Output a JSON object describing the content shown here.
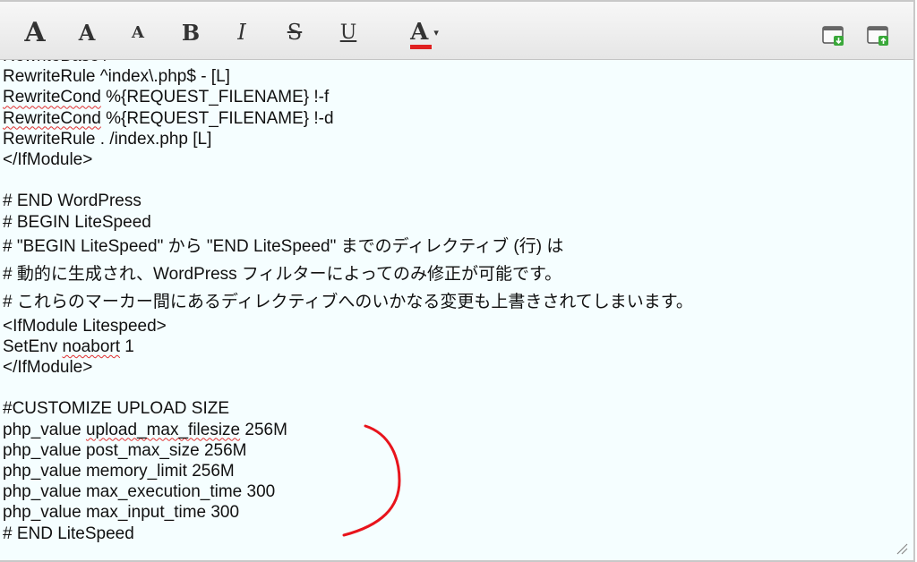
{
  "toolbar": {
    "font_large": "A",
    "font_medium": "A",
    "font_small": "A",
    "bold": "B",
    "italic": "I",
    "strike": "S",
    "underline": "U",
    "text_color": "A",
    "text_color_caret": "▾",
    "text_color_swatch": "#e02020"
  },
  "editor": {
    "background": "#f5feff",
    "lines": [
      {
        "pre": "",
        "sp": "",
        "post": "RewriteBase /"
      },
      {
        "pre": "",
        "sp": "",
        "post": "RewriteRule ^index\\.php$ - [L]"
      },
      {
        "pre": "",
        "sp": "RewriteCond",
        "post": " %{REQUEST_FILENAME} !-f"
      },
      {
        "pre": "",
        "sp": "RewriteCond",
        "post": " %{REQUEST_FILENAME} !-d"
      },
      {
        "pre": "",
        "sp": "",
        "post": "RewriteRule . /index.php [L]"
      },
      {
        "pre": "",
        "sp": "",
        "post": "</IfModule>"
      },
      {
        "pre": "",
        "sp": "",
        "post": ""
      },
      {
        "pre": "",
        "sp": "",
        "post": "# END WordPress"
      },
      {
        "pre": "",
        "sp": "",
        "post": "# BEGIN LiteSpeed"
      },
      {
        "pre": "",
        "sp": "",
        "post": "# \"BEGIN LiteSpeed\" から \"END LiteSpeed\" までのディレクティブ (行) は",
        "tall": true
      },
      {
        "pre": "",
        "sp": "",
        "post": "# 動的に生成され、WordPress フィルターによってのみ修正が可能です。",
        "tall": true
      },
      {
        "pre": "",
        "sp": "",
        "post": "# これらのマーカー間にあるディレクティブへのいかなる変更も上書きされてしまいます。",
        "tall": true
      },
      {
        "pre": "",
        "sp": "",
        "post": "<IfModule Litespeed>"
      },
      {
        "pre": "SetEnv ",
        "sp": "noabort",
        "post": " 1"
      },
      {
        "pre": "",
        "sp": "",
        "post": "</IfModule>"
      },
      {
        "pre": "",
        "sp": "",
        "post": ""
      },
      {
        "pre": "",
        "sp": "",
        "post": "#CUSTOMIZE UPLOAD SIZE"
      },
      {
        "pre": "php_value ",
        "sp": "upload_max_filesize",
        "post": " 256M"
      },
      {
        "pre": "",
        "sp": "",
        "post": "php_value post_max_size 256M"
      },
      {
        "pre": "",
        "sp": "",
        "post": "php_value memory_limit 256M"
      },
      {
        "pre": "",
        "sp": "",
        "post": "php_value max_execution_time 300"
      },
      {
        "pre": "",
        "sp": "",
        "post": "php_value max_input_time 300"
      },
      {
        "pre": "",
        "sp": "",
        "post": "# END LiteSpeed"
      }
    ]
  },
  "icons": {
    "download": "window-download-icon",
    "upload": "window-upload-icon",
    "resize": "resize-handle-icon",
    "annotation": "red-bracket-annotation",
    "icon_green": "#3aa83a",
    "annotation_color": "#e8141c"
  }
}
